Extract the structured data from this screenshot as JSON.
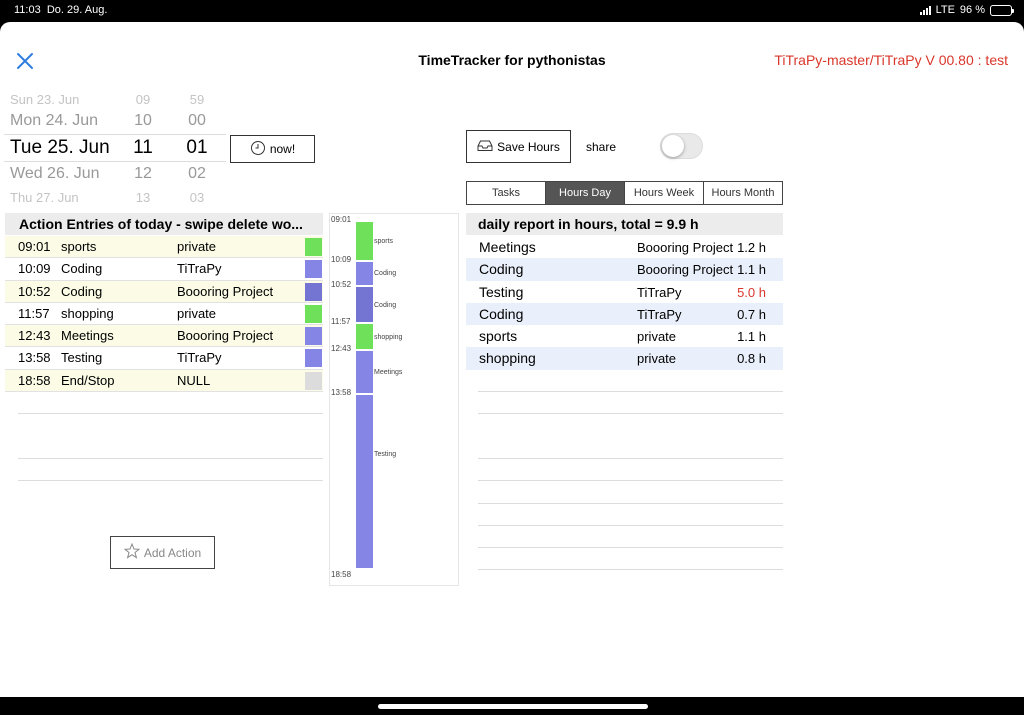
{
  "status_bar": {
    "time": "11:03",
    "date": "Do. 29. Aug.",
    "network": "LTE",
    "battery": "96 %",
    "battery_level": 0.96
  },
  "nav": {
    "title": "TimeTracker for pythonistas",
    "version": "TiTraPy-master/TiTraPy V 00.80 : test",
    "close_icon": "close-icon"
  },
  "picker": {
    "rows": [
      {
        "date": "Sun 23. Jun",
        "hour": "09",
        "min": "59"
      },
      {
        "date": "Mon 24. Jun",
        "hour": "10",
        "min": "00"
      },
      {
        "date": "Tue 25. Jun",
        "hour": "11",
        "min": "01"
      },
      {
        "date": "Wed 26. Jun",
        "hour": "12",
        "min": "02"
      },
      {
        "date": "Thu 27. Jun",
        "hour": "13",
        "min": "03"
      }
    ]
  },
  "now_button": {
    "label": "now!",
    "icon": "clock-icon"
  },
  "save_button": {
    "label": "Save Hours",
    "icon": "tray-icon"
  },
  "share": {
    "label": "share",
    "on": false
  },
  "tabs": [
    {
      "label": "Tasks",
      "active": false
    },
    {
      "label": "Hours Day",
      "active": true
    },
    {
      "label": "Hours Week",
      "active": false
    },
    {
      "label": "Hours Month",
      "active": false
    }
  ],
  "actions": {
    "header": "Action Entries of today - swipe delete wo...",
    "entries": [
      {
        "time": "09:01",
        "action": "sports",
        "project": "private",
        "color": "#6ee05a"
      },
      {
        "time": "10:09",
        "action": "Coding",
        "project": "TiTraPy",
        "color": "#8585e6"
      },
      {
        "time": "10:52",
        "action": "Coding",
        "project": "Boooring Project",
        "color": "#7474d3"
      },
      {
        "time": "11:57",
        "action": "shopping",
        "project": "private",
        "color": "#6ee05a"
      },
      {
        "time": "12:43",
        "action": "Meetings",
        "project": "Boooring Project",
        "color": "#8585e6"
      },
      {
        "time": "13:58",
        "action": "Testing",
        "project": "TiTraPy",
        "color": "#8585e6"
      },
      {
        "time": "18:58",
        "action": "End/Stop",
        "project": "NULL",
        "color": "#dcdcdc"
      }
    ],
    "add_label": "Add Action",
    "add_icon": "star-icon"
  },
  "timeline": {
    "segments": [
      {
        "start": "09:01",
        "label": "sports",
        "color": "#6ee05a",
        "hours": 1.13
      },
      {
        "start": "10:09",
        "label": "Coding",
        "color": "#8585e6",
        "hours": 0.72
      },
      {
        "start": "10:52",
        "label": "Coding",
        "color": "#7474d3",
        "hours": 1.08
      },
      {
        "start": "11:57",
        "label": "shopping",
        "color": "#6ee05a",
        "hours": 0.77
      },
      {
        "start": "12:43",
        "label": "Meetings",
        "color": "#8585e6",
        "hours": 1.25
      },
      {
        "start": "13:58",
        "label": "Testing",
        "color": "#8585e6",
        "hours": 5.0
      }
    ],
    "end": "18:58"
  },
  "report": {
    "header": "daily report in hours, total = 9.9 h",
    "rows": [
      {
        "action": "Meetings",
        "project": "Boooring Project",
        "hours": "1.2 h",
        "highlight": false
      },
      {
        "action": "Coding",
        "project": "Boooring Project",
        "hours": "1.1 h",
        "highlight": false
      },
      {
        "action": "Testing",
        "project": "TiTraPy",
        "hours": "5.0 h",
        "highlight": true
      },
      {
        "action": "Coding",
        "project": "TiTraPy",
        "hours": "0.7 h",
        "highlight": false
      },
      {
        "action": "sports",
        "project": "private",
        "hours": "1.1 h",
        "highlight": false
      },
      {
        "action": "shopping",
        "project": "private",
        "hours": "0.8 h",
        "highlight": false
      }
    ]
  }
}
